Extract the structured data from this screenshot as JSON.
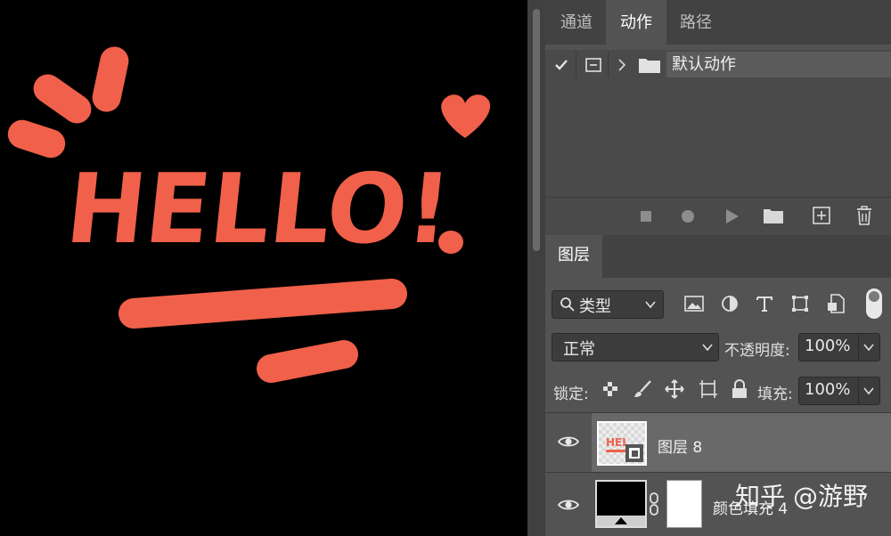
{
  "colors": {
    "hello_coral": "#F0604A",
    "panel_bg": "#535353",
    "panel_dark": "#424242",
    "field_bg": "#3c3c3c"
  },
  "canvas": {
    "artwork_text": "HELLO!"
  },
  "actions_panel": {
    "tabs": [
      {
        "label": "通道"
      },
      {
        "label": "动作"
      },
      {
        "label": "路径"
      }
    ],
    "active_tab": "动作",
    "set_name": "默认动作",
    "toolbar_icons": [
      "stop-icon",
      "record-icon",
      "play-icon",
      "new-set-folder-icon",
      "new-action-icon",
      "delete-icon"
    ]
  },
  "layers_panel": {
    "tab_label": "图层",
    "filter": {
      "value": "类型",
      "icons": [
        "image-filter-icon",
        "adjustment-filter-icon",
        "type-filter-icon",
        "shape-filter-icon",
        "smart-object-filter-icon"
      ]
    },
    "blend_mode": "正常",
    "opacity_label": "不透明度:",
    "opacity_value": "100%",
    "lock_label": "锁定:",
    "fill_label": "填充:",
    "fill_value": "100%",
    "layers": [
      {
        "name": "图层 8",
        "visible": true,
        "selected": true
      },
      {
        "name": "颜色填充 4",
        "visible": true,
        "selected": false
      }
    ]
  },
  "watermark": "知乎 @游野"
}
